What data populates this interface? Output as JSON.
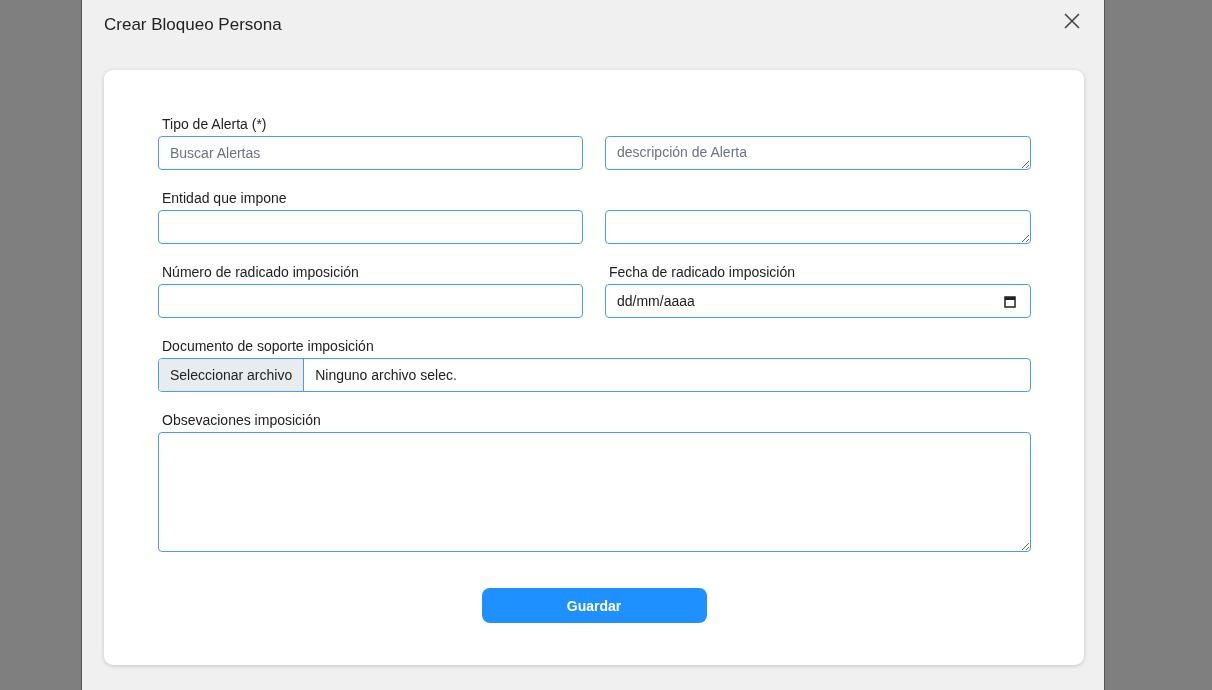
{
  "dialog": {
    "title": "Crear Bloqueo Persona"
  },
  "fields": [
    {
      "kind": "text",
      "label": "Tipo de Alerta (*)",
      "placeholder": "Buscar Alertas"
    },
    {
      "kind": "textarea",
      "placeholder": "descripción de Alerta"
    },
    {
      "kind": "text",
      "label": "Entidad que impone"
    },
    {
      "kind": "textarea"
    },
    {
      "kind": "text",
      "label": "Número de radicado imposición"
    },
    {
      "kind": "date",
      "label": "Fecha de radicado imposición",
      "value": "dd/mm/aaaa"
    },
    {
      "kind": "file",
      "label": "Documento de soporte imposición",
      "button": "Seleccionar archivo",
      "value": "Ninguno archivo selec."
    },
    {
      "kind": "bigtextarea",
      "label": "Obsevaciones imposición"
    }
  ],
  "submit": {
    "label": "Guardar"
  }
}
